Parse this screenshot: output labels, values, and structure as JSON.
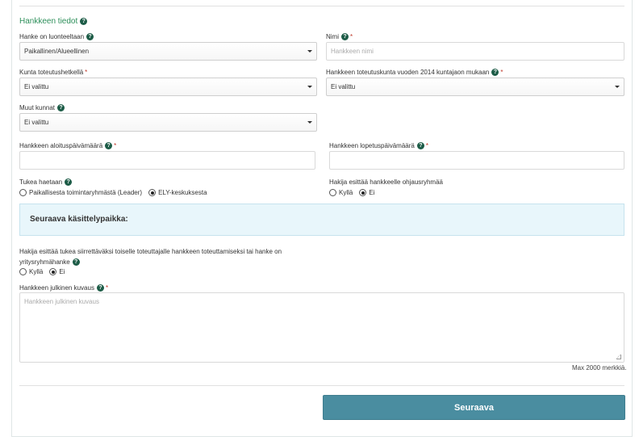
{
  "section": {
    "title": "Hankkeen tiedot"
  },
  "fields": {
    "nature": {
      "label": "Hanke on luonteeltaan",
      "value": "Paikallinen/Alueellinen"
    },
    "name": {
      "label": "Nimi",
      "placeholder": "Hankkeen nimi"
    },
    "municipality": {
      "label": "Kunta toteutushetkellä",
      "value": "Ei valittu"
    },
    "municipality2014": {
      "label": "Hankkeen toteutuskunta vuoden 2014 kuntajaon mukaan",
      "value": "Ei valittu"
    },
    "otherMunicipalities": {
      "label": "Muut kunnat",
      "value": "Ei valittu"
    },
    "startDate": {
      "label": "Hankkeen aloituspäivämäärä"
    },
    "endDate": {
      "label": "Hankkeen lopetuspäivämäärä"
    },
    "supportSought": {
      "label": "Tukea haetaan",
      "options": [
        "Paikallisesta toimintaryhmästä (Leader)",
        "ELY-keskuksesta"
      ],
      "selected": "ELY-keskuksesta"
    },
    "steeringGroup": {
      "label": "Hakija esittää hankkeelle ohjausryhmää",
      "options": [
        "Kyllä",
        "Ei"
      ],
      "selected": "Ei"
    },
    "transferable": {
      "label_line1": "Hakija esittää tukea siirrettäväksi toiselle toteuttajalle hankkeen toteuttamiseksi tai hanke on",
      "label_line2": "yritysryhmähanke",
      "options": [
        "Kyllä",
        "Ei"
      ],
      "selected": "Ei"
    },
    "publicDescription": {
      "label": "Hankkeen julkinen kuvaus",
      "placeholder": "Hankkeen julkinen kuvaus",
      "maxNote": "Max 2000 merkkiä."
    }
  },
  "infoBox": {
    "text": "Seuraava käsittelypaikka:"
  },
  "requiredMark": "*",
  "helpGlyph": "?",
  "buttons": {
    "next": "Seuraava"
  }
}
